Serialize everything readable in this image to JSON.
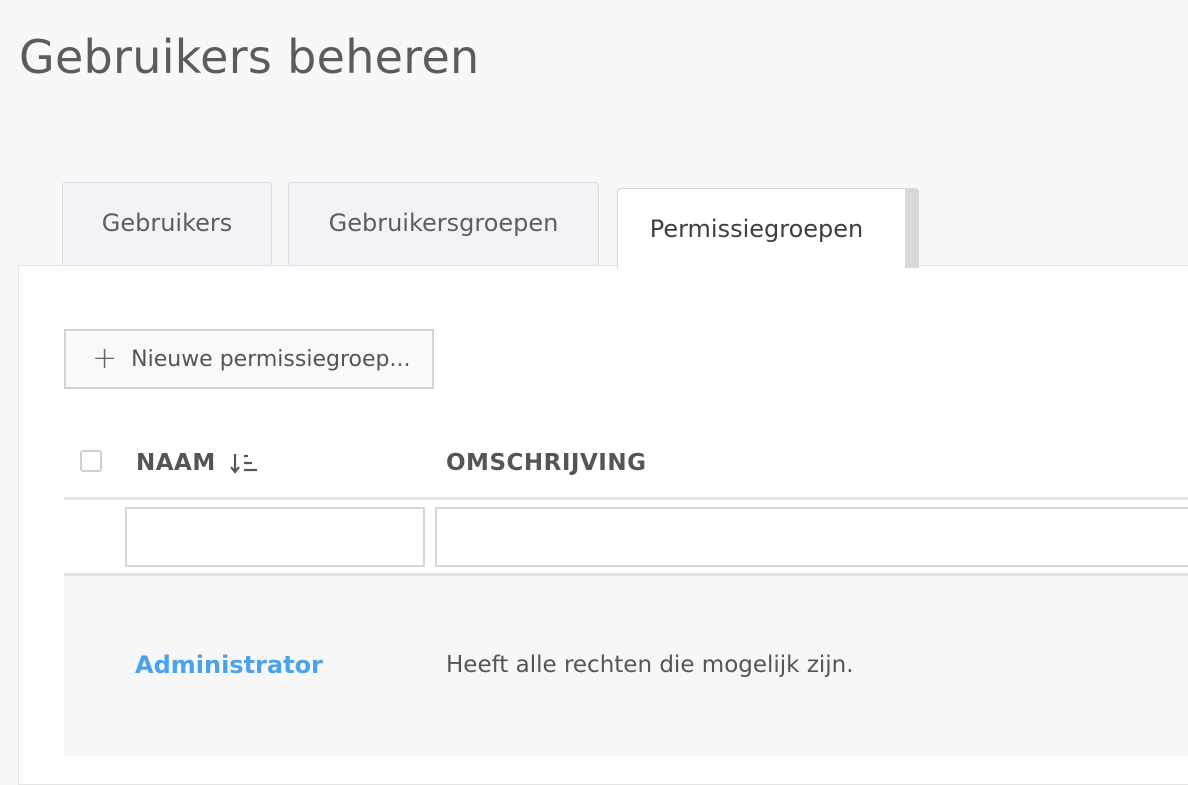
{
  "page": {
    "title": "Gebruikers beheren"
  },
  "tabs": [
    {
      "label": "Gebruikers",
      "active": false
    },
    {
      "label": "Gebruikersgroepen",
      "active": false
    },
    {
      "label": "Permissiegroepen",
      "active": true
    }
  ],
  "toolbar": {
    "new_button_label": "Nieuwe permissiegroep..."
  },
  "table": {
    "columns": [
      {
        "label": "NAAM",
        "sorted": "ascending"
      },
      {
        "label": "OMSCHRIJVING"
      }
    ],
    "filters": {
      "naam": "",
      "omschrijving": ""
    },
    "rows": [
      {
        "naam": "Administrator",
        "omschrijving": "Heeft alle rechten die mogelijk zijn."
      }
    ]
  },
  "colors": {
    "link": "#4aa3ea",
    "background": "#f8f8f9",
    "panel": "#ffffff"
  },
  "icons": {
    "new_button": "plus-icon",
    "sort": "sort-ascending-icon"
  }
}
